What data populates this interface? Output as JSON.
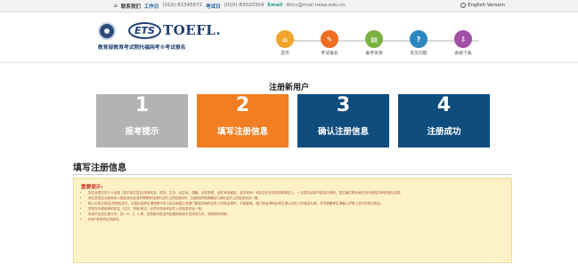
{
  "topbar": {
    "home": "联系我们",
    "phone_label": "工作日",
    "phone_value": "(010)-82345672",
    "exam_label": "考试日",
    "exam_value": "(010)-83020304",
    "email_label": "Email",
    "email_value": "ibtcc@mail.neea.edu.cn",
    "english": "English Version"
  },
  "header": {
    "logo_ets": "ETS",
    "logo_toefl": "TOEFL.",
    "subtitle": "教育部教育考试院托福网考®考试报名",
    "steps": [
      {
        "label": "首页",
        "color": "#f0a52b",
        "icon": "home-icon"
      },
      {
        "label": "考试报名",
        "color": "#f06d24",
        "icon": "clipboard-icon"
      },
      {
        "label": "备考资源",
        "color": "#7bb342",
        "icon": "book-icon"
      },
      {
        "label": "常见问题",
        "color": "#2e86c1",
        "icon": "question-icon"
      },
      {
        "label": "表格下载",
        "color": "#a24fa6",
        "icon": "download-icon"
      }
    ]
  },
  "page_title": "注册新用户",
  "reg_steps": [
    {
      "num": "1",
      "label": "报考提示",
      "color": "#b3b3b3"
    },
    {
      "num": "2",
      "label": "填写注册信息",
      "color": "#f17e22"
    },
    {
      "num": "3",
      "label": "确认注册信息",
      "color": "#0e4d7e"
    },
    {
      "num": "4",
      "label": "注册成功",
      "color": "#0e4d7e"
    }
  ],
  "section_title": "填写注册信息",
  "notice": {
    "title": "重要提示:",
    "items": [
      "您在此提交的个人信息（如中英文姓名/拼音姓名、性别、生日、出生地、国籍、证件类型、证件有效期至、证件号码）将会显示在您的成绩报告上，一旦提交后将不能自行修改，您应通过联系我们进行修改并承担相应后果。",
      "请注意您应当使用本人居民身份证或护照等有效身份证件上的信息填写，如使用护照请确保与身份证件上的信息完全一致。",
      "输入中英文姓名/拼音姓名时，中国大陆考生请按照中华人民共和国公安部门颁发的身份证件上的姓名填写；中国香港、澳门和台湾地区考生请以证件上的姓名为准；非中国籍考生请输入护照上显示的英文姓名。",
      "您所在时候使用的姓名（中文、拼音/英文）必须与您参考证件上的信息完全一致。",
      "系统不支持生僻汉字、如：※、§、¤ 等，在您填写姓名时如遇到系统不支持的汉字，请您填写拼音。",
      "所有*号的项必须填写。"
    ]
  }
}
